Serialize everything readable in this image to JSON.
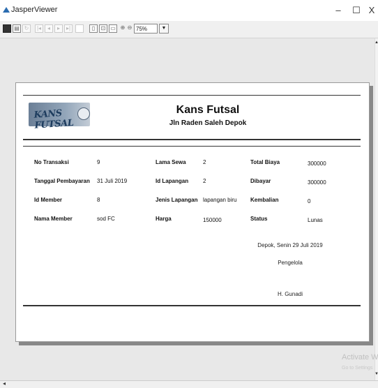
{
  "window": {
    "title": "JasperViewer",
    "minimize_glyph": "–",
    "maximize_glyph": "☐",
    "close_glyph": "X"
  },
  "toolbar": {
    "zoom_value": "75%",
    "icons": [
      "save-icon",
      "print-icon",
      "reload-icon",
      "first-page-icon",
      "previous-page-icon",
      "next-page-icon",
      "last-page-icon",
      "actual-size-icon",
      "fit-page-icon",
      "fit-width-icon",
      "zoom-in-icon",
      "zoom-out-icon"
    ]
  },
  "report": {
    "logo_text": "KANS FUTSAL",
    "company_name": "Kans Futsal",
    "address": "Jln Raden Saleh Depok",
    "fields": {
      "no_transaksi": {
        "label": "No Transaksi",
        "value": "9"
      },
      "tanggal_pembayaran": {
        "label": "Tanggal Pembayaran",
        "value": "31 Juli 2019"
      },
      "id_member": {
        "label": "Id Member",
        "value": "8"
      },
      "nama_member": {
        "label": "Nama Member",
        "value": "sod FC"
      },
      "lama_sewa": {
        "label": "Lama Sewa",
        "value": "2"
      },
      "id_lapangan": {
        "label": "Id Lapangan",
        "value": "2"
      },
      "jenis_lapangan": {
        "label": "Jenis Lapangan",
        "value": "lapangan biru"
      },
      "harga": {
        "label": "Harga",
        "value": "150000"
      },
      "total_biaya": {
        "label": "Total Biaya",
        "value": "300000"
      },
      "dibayar": {
        "label": "Dibayar",
        "value": "300000"
      },
      "kembalian": {
        "label": "Kembalian",
        "value": "0"
      },
      "status": {
        "label": "Status",
        "value": "Lunas"
      }
    },
    "signature": {
      "place_date": "Depok, Senin 29 Juli 2019",
      "role": "Pengelola",
      "name": "H. Gunadi"
    }
  },
  "os_watermark": {
    "line1": "Activate W",
    "line2": "Go to Settings"
  }
}
